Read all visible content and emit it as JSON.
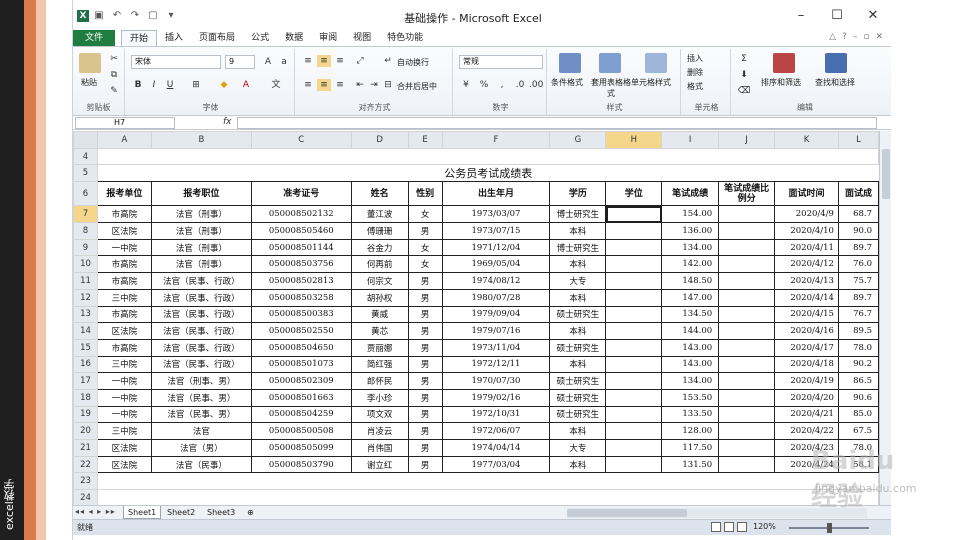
{
  "side_label": "excel教学",
  "window": {
    "title": "基础操作 - Microsoft Excel",
    "controls": [
      "–",
      "☐",
      "✕"
    ]
  },
  "tabs": {
    "file": "文件",
    "items": [
      "开始",
      "插入",
      "页面布局",
      "公式",
      "数据",
      "审阅",
      "视图",
      "特色功能"
    ]
  },
  "ribbon": {
    "clipboard": {
      "label": "剪贴板",
      "paste": "粘贴"
    },
    "font": {
      "label": "字体",
      "name": "宋体",
      "size": "9"
    },
    "alignment": {
      "label": "对齐方式",
      "wrap": "自动换行",
      "merge": "合并后居中"
    },
    "number": {
      "label": "数字",
      "format": "常规"
    },
    "styles": {
      "label": "样式",
      "cond": "条件格式",
      "table": "套用表格格式",
      "cell": "单元格样式"
    },
    "cells": {
      "label": "单元格",
      "insert": "插入",
      "delete": "删除",
      "format": "格式"
    },
    "editing": {
      "label": "编辑",
      "sort": "排序和筛选",
      "find": "查找和选择"
    }
  },
  "formula_bar": {
    "name_box": "H7",
    "fx": "fx",
    "value": ""
  },
  "sheet": {
    "columns": [
      "A",
      "B",
      "C",
      "D",
      "E",
      "F",
      "G",
      "H",
      "I",
      "J",
      "K",
      "L"
    ],
    "selected_cell": "H7",
    "table_title": "公务员考试成绩表",
    "headers": [
      "报考单位",
      "报考职位",
      "准考证号",
      "姓名",
      "性别",
      "出生年月",
      "学历",
      "学位",
      "笔试成绩",
      "笔试成绩比例分",
      "面试时间",
      "面试成"
    ],
    "rows": [
      {
        "n": "7",
        "cells": [
          "市高院",
          "法官（刑事）",
          "050008502132",
          "董江波",
          "女",
          "1973/03/07",
          "博士研究生",
          "",
          "154.00",
          "",
          "2020/4/9",
          "68.7"
        ]
      },
      {
        "n": "8",
        "cells": [
          "区法院",
          "法官（刑事）",
          "050008505460",
          "傅珊珊",
          "男",
          "1973/07/15",
          "本科",
          "",
          "136.00",
          "",
          "2020/4/10",
          "90.0"
        ]
      },
      {
        "n": "9",
        "cells": [
          "一中院",
          "法官（刑事）",
          "050008501144",
          "谷金力",
          "女",
          "1971/12/04",
          "博士研究生",
          "",
          "134.00",
          "",
          "2020/4/11",
          "89.7"
        ]
      },
      {
        "n": "10",
        "cells": [
          "市高院",
          "法官（刑事）",
          "050008503756",
          "何再前",
          "女",
          "1969/05/04",
          "本科",
          "",
          "142.00",
          "",
          "2020/4/12",
          "76.0"
        ]
      },
      {
        "n": "11",
        "cells": [
          "市高院",
          "法官（民事、行政）",
          "050008502813",
          "何宗文",
          "男",
          "1974/08/12",
          "大专",
          "",
          "148.50",
          "",
          "2020/4/13",
          "75.7"
        ]
      },
      {
        "n": "12",
        "cells": [
          "三中院",
          "法官（民事、行政）",
          "050008503258",
          "胡孙权",
          "男",
          "1980/07/28",
          "本科",
          "",
          "147.00",
          "",
          "2020/4/14",
          "89.7"
        ]
      },
      {
        "n": "13",
        "cells": [
          "市高院",
          "法官（民事、行政）",
          "050008500383",
          "黄威",
          "男",
          "1979/09/04",
          "硕士研究生",
          "",
          "134.50",
          "",
          "2020/4/15",
          "76.7"
        ]
      },
      {
        "n": "14",
        "cells": [
          "区法院",
          "法官（民事、行政）",
          "050008502550",
          "黄芯",
          "男",
          "1979/07/16",
          "本科",
          "",
          "144.00",
          "",
          "2020/4/16",
          "89.5"
        ]
      },
      {
        "n": "15",
        "cells": [
          "市高院",
          "法官（民事、行政）",
          "050008504650",
          "贾丽娜",
          "男",
          "1973/11/04",
          "硕士研究生",
          "",
          "143.00",
          "",
          "2020/4/17",
          "78.0"
        ]
      },
      {
        "n": "16",
        "cells": [
          "三中院",
          "法官（民事、行政）",
          "050008501073",
          "简红强",
          "男",
          "1972/12/11",
          "本科",
          "",
          "143.00",
          "",
          "2020/4/18",
          "90.2"
        ]
      },
      {
        "n": "17",
        "cells": [
          "一中院",
          "法官（刑事、男）",
          "050008502309",
          "郎怀民",
          "男",
          "1970/07/30",
          "硕士研究生",
          "",
          "134.00",
          "",
          "2020/4/19",
          "86.5"
        ]
      },
      {
        "n": "18",
        "cells": [
          "一中院",
          "法官（民事、男）",
          "050008501663",
          "李小珍",
          "男",
          "1979/02/16",
          "硕士研究生",
          "",
          "153.50",
          "",
          "2020/4/20",
          "90.6"
        ]
      },
      {
        "n": "19",
        "cells": [
          "一中院",
          "法官（民事、男）",
          "050008504259",
          "项文双",
          "男",
          "1972/10/31",
          "硕士研究生",
          "",
          "133.50",
          "",
          "2020/4/21",
          "85.0"
        ]
      },
      {
        "n": "20",
        "cells": [
          "三中院",
          "法官",
          "050008500508",
          "肖凌云",
          "男",
          "1972/06/07",
          "本科",
          "",
          "128.00",
          "",
          "2020/4/22",
          "67.5"
        ]
      },
      {
        "n": "21",
        "cells": [
          "区法院",
          "法官（男）",
          "050008505099",
          "肖伟国",
          "男",
          "1974/04/14",
          "大专",
          "",
          "117.50",
          "",
          "2020/4/23",
          "78.0"
        ]
      },
      {
        "n": "22",
        "cells": [
          "区法院",
          "法官（民事）",
          "050008503790",
          "谢立红",
          "男",
          "1977/03/04",
          "本科",
          "",
          "131.50",
          "",
          "2020/4/24",
          "58.1"
        ]
      }
    ],
    "row_numbers_top": [
      "4",
      "5",
      "6"
    ],
    "row_numbers_bottom": [
      "23",
      "24"
    ],
    "tabs": [
      "Sheet1",
      "Sheet2",
      "Sheet3"
    ],
    "active_tab": "Sheet1"
  },
  "status": {
    "ready": "就绪",
    "zoom": "120%"
  },
  "watermark": {
    "main": "Baidu经验",
    "sub": "jingyan.baidu.com"
  }
}
